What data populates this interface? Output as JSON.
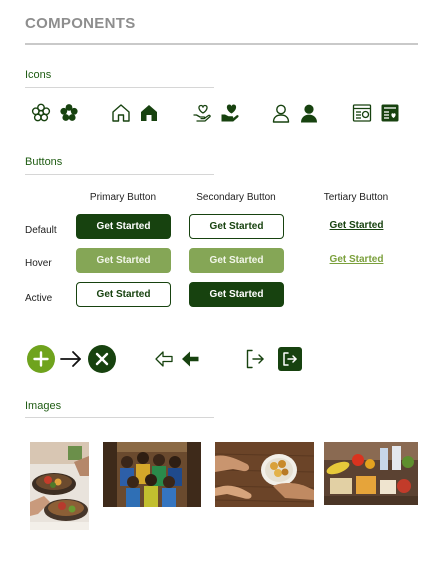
{
  "page": {
    "title": "COMPONENTS"
  },
  "sections": {
    "icons": "Icons",
    "buttons": "Buttons",
    "images": "Images"
  },
  "icons_row": [
    "flower-outline-icon",
    "flower-filled-icon",
    "home-outline-icon",
    "home-filled-icon",
    "heart-hand-outline-icon",
    "heart-hand-filled-icon",
    "user-outline-icon",
    "user-filled-icon",
    "news-outline-icon",
    "news-filled-icon"
  ],
  "buttons": {
    "columns": [
      "Primary Button",
      "Secondary Button",
      "Tertiary Button"
    ],
    "rows": [
      "Default",
      "Hover",
      "Active"
    ],
    "label": "Get Started"
  },
  "actions_row": [
    "plus-circle-icon",
    "arrow-right-icon",
    "close-circle-icon",
    "arrow-left-outline-icon",
    "arrow-left-filled-icon",
    "logout-outline-icon",
    "logout-filled-icon"
  ],
  "images": [
    "food-bowls-image",
    "children-group-image",
    "hands-sharing-food-image",
    "groceries-image"
  ],
  "colors": {
    "primary": "#17420f",
    "hover": "#85a656",
    "accent": "#6fa31d",
    "label": "#1f5c13",
    "muted": "#8e8e8e"
  }
}
